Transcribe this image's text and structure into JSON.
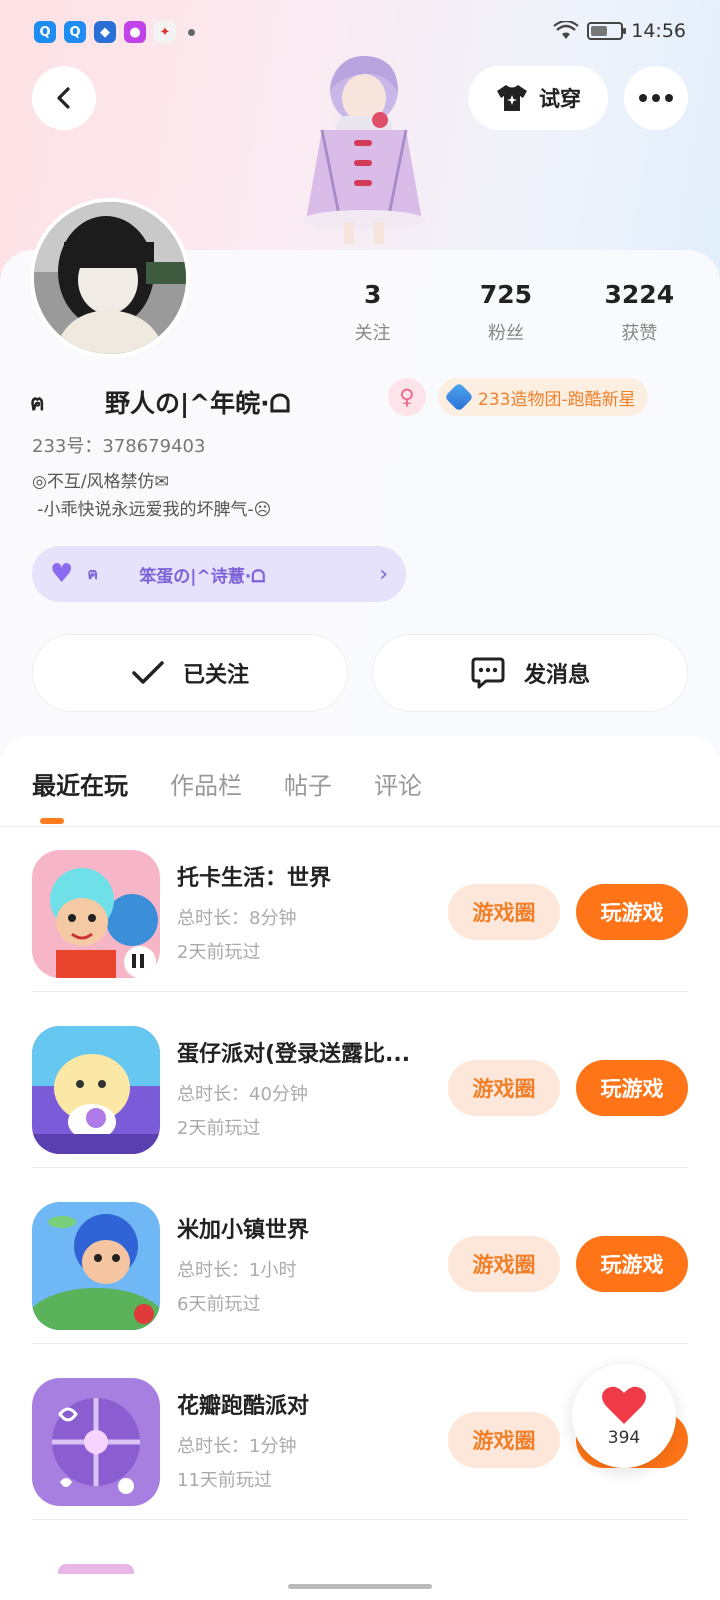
{
  "status_bar": {
    "time": "14:56",
    "app_icons": [
      "qq-icon",
      "qq-icon",
      "app-icon",
      "app-icon",
      "app-icon"
    ]
  },
  "header": {
    "try_on_label": "试穿"
  },
  "profile": {
    "stats": [
      {
        "value": "3",
        "label": "关注"
      },
      {
        "value": "725",
        "label": "粉丝"
      },
      {
        "value": "3224",
        "label": "获赞"
      }
    ],
    "name_prefix": "ฅ",
    "nickname": "野人の|^年皖·ᗝ",
    "gender_symbol": "♀",
    "badge": "233造物团-跑酷新星",
    "uid": "233号：378679403",
    "bio": "◎不互/风格禁仿✉\n -小乖快说永远爱我的坏脾气-☹",
    "cp": {
      "prefix": "ฅ",
      "name": "笨蛋の|^诗薏·ᗝ"
    },
    "follow_label": "已关注",
    "message_label": "发消息"
  },
  "tabs": [
    "最近在玩",
    "作品栏",
    "帖子",
    "评论"
  ],
  "games": [
    {
      "title": "托卡生活：世界",
      "duration": "总时长：8分钟",
      "last_played": "2天前玩过",
      "circle_label": "游戏圈",
      "play_label": "玩游戏"
    },
    {
      "title": "蛋仔派对(登录送露比...",
      "duration": "总时长：40分钟",
      "last_played": "2天前玩过",
      "circle_label": "游戏圈",
      "play_label": "玩游戏"
    },
    {
      "title": "米加小镇世界",
      "duration": "总时长：1小时",
      "last_played": "6天前玩过",
      "circle_label": "游戏圈",
      "play_label": "玩游戏"
    },
    {
      "title": "花瓣跑酷派对",
      "duration": "总时长：1分钟",
      "last_played": "11天前玩过",
      "circle_label": "游戏圈",
      "play_label": "玩游戏"
    }
  ],
  "like_button": {
    "count": "394"
  },
  "colors": {
    "accent": "#ff7416",
    "accent_soft": "#fde7da",
    "cp_purple": "#7d62d8"
  }
}
